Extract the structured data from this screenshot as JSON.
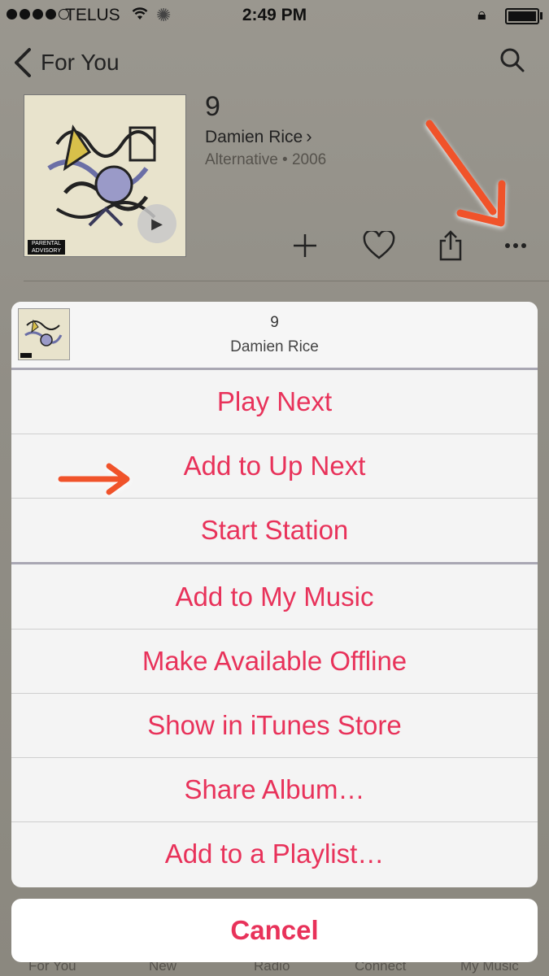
{
  "status_bar": {
    "carrier": "TELUS",
    "time": "2:49 PM",
    "signal_bars_filled": 4,
    "signal_bars_total": 5
  },
  "nav": {
    "back_label": "For You"
  },
  "album": {
    "title": "9",
    "artist": "Damien Rice",
    "genre_year": "Alternative • 2006"
  },
  "action_sheet": {
    "header_title": "9",
    "header_artist": "Damien Rice",
    "items": [
      {
        "label": "Play Next"
      },
      {
        "label": "Add to Up Next"
      },
      {
        "label": "Start Station"
      },
      {
        "label": "Add to My Music"
      },
      {
        "label": "Make Available Offline"
      },
      {
        "label": "Show in iTunes Store"
      },
      {
        "label": "Share Album…"
      },
      {
        "label": "Add to a Playlist…"
      }
    ],
    "cancel_label": "Cancel",
    "accent_color": "#e8325a"
  },
  "tab_bar": {
    "tabs": [
      "For You",
      "New",
      "Radio",
      "Connect",
      "My Music"
    ]
  },
  "annotation_color": "#f0522a"
}
